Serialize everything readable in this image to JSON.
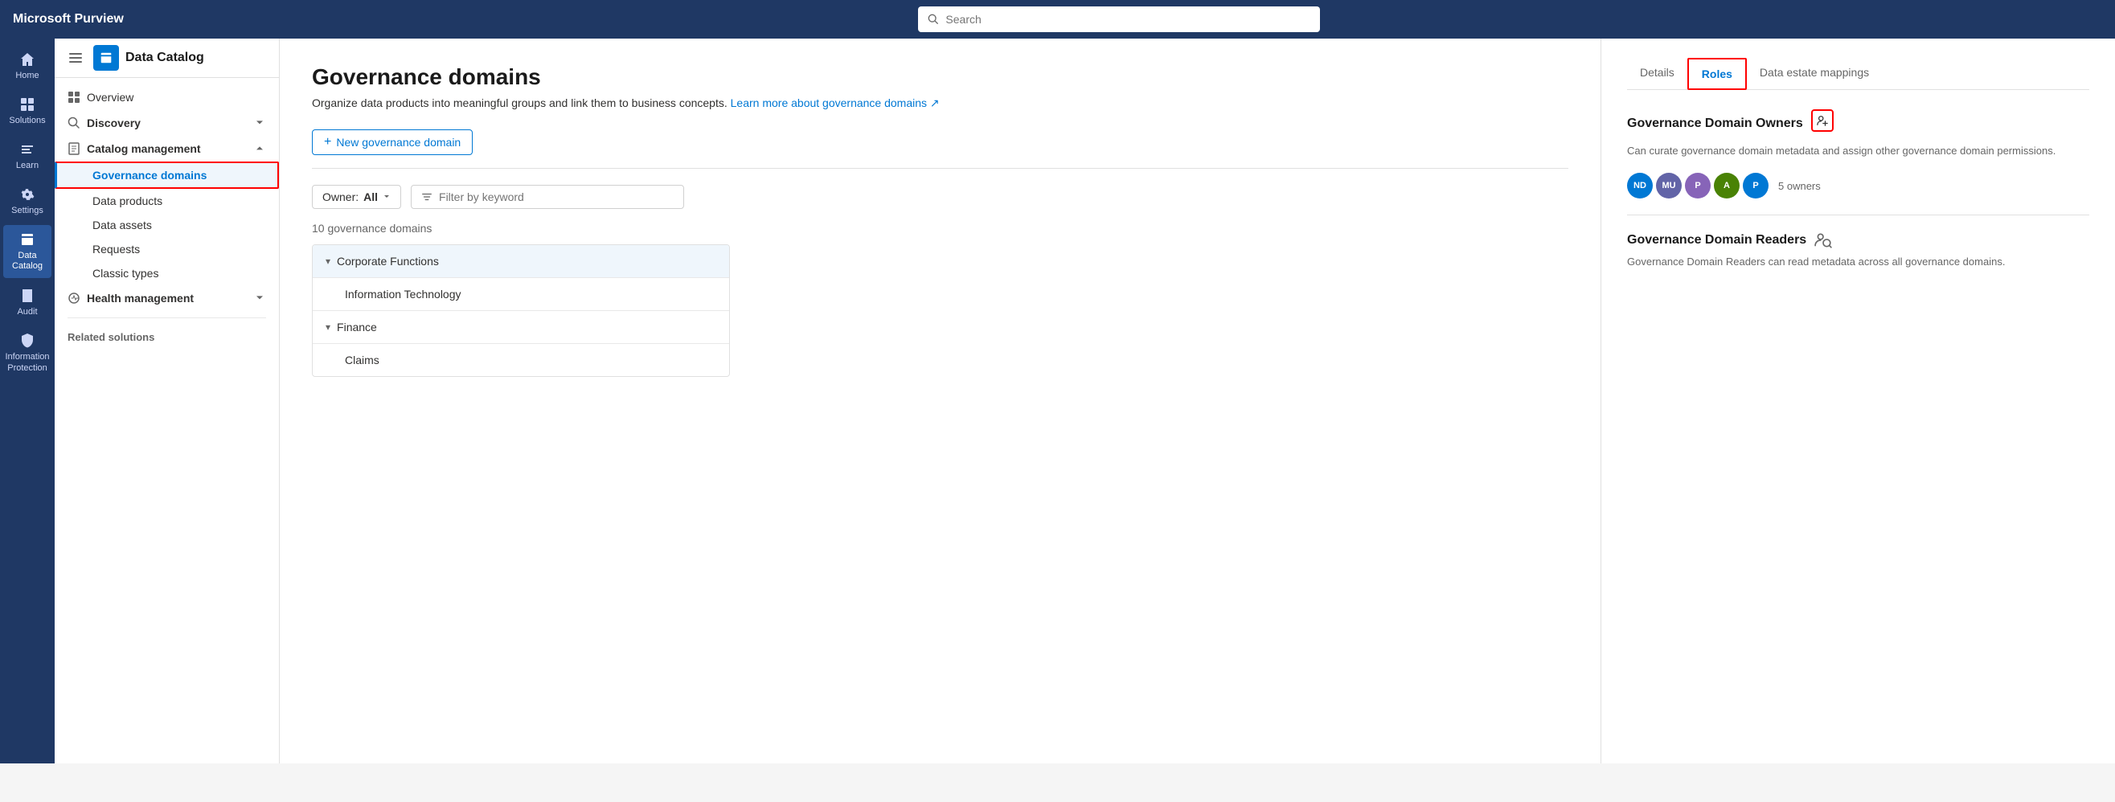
{
  "topbar": {
    "title": "Microsoft Purview",
    "search_placeholder": "Search"
  },
  "icon_nav": {
    "items": [
      {
        "id": "home",
        "label": "Home",
        "icon": "home"
      },
      {
        "id": "solutions",
        "label": "Solutions",
        "icon": "grid"
      },
      {
        "id": "learn",
        "label": "Learn",
        "icon": "book"
      },
      {
        "id": "settings",
        "label": "Settings",
        "icon": "gear"
      },
      {
        "id": "data-catalog",
        "label": "Data Catalog",
        "icon": "catalog",
        "active": true
      },
      {
        "id": "audit",
        "label": "Audit",
        "icon": "audit"
      },
      {
        "id": "info-protection",
        "label": "Information Protection",
        "icon": "shield"
      }
    ]
  },
  "sidebar": {
    "app_name": "Data Catalog",
    "nav_items": [
      {
        "id": "overview",
        "label": "Overview",
        "icon": "grid"
      }
    ],
    "sections": [
      {
        "id": "discovery",
        "label": "Discovery",
        "icon": "search",
        "expanded": false
      },
      {
        "id": "catalog-management",
        "label": "Catalog management",
        "icon": "book",
        "expanded": true,
        "sub_items": [
          {
            "id": "governance-domains",
            "label": "Governance domains",
            "active": true
          },
          {
            "id": "data-products",
            "label": "Data products"
          },
          {
            "id": "data-assets",
            "label": "Data assets"
          },
          {
            "id": "requests",
            "label": "Requests"
          },
          {
            "id": "classic-types",
            "label": "Classic types"
          }
        ]
      },
      {
        "id": "health-management",
        "label": "Health management",
        "icon": "health",
        "expanded": false
      }
    ],
    "related_label": "Related solutions"
  },
  "main": {
    "page_title": "Governance domains",
    "page_desc": "Organize data products into meaningful groups and link them to business concepts.",
    "learn_link": "Learn more about governance domains",
    "new_button": "New governance domain",
    "owner_filter_label": "Owner:",
    "owner_filter_value": "All",
    "filter_placeholder": "Filter by keyword",
    "domains_count": "10 governance domains",
    "domains": [
      {
        "id": "corporate-functions",
        "name": "Corporate Functions",
        "level": 0,
        "expanded": true,
        "has_children": true
      },
      {
        "id": "information-technology",
        "name": "Information Technology",
        "level": 1,
        "expanded": false,
        "has_children": false
      },
      {
        "id": "finance",
        "name": "Finance",
        "level": 0,
        "expanded": true,
        "has_children": true
      },
      {
        "id": "claims",
        "name": "Claims",
        "level": 1,
        "expanded": false,
        "has_children": false
      }
    ]
  },
  "right_panel": {
    "tabs": [
      {
        "id": "details",
        "label": "Details"
      },
      {
        "id": "roles",
        "label": "Roles",
        "active": true
      },
      {
        "id": "data-estate-mappings",
        "label": "Data estate mappings"
      }
    ],
    "owners_section": {
      "title": "Governance Domain Owners",
      "description": "Can curate governance domain metadata and assign other governance domain permissions.",
      "owners": [
        {
          "initials": "ND",
          "color": "#0078d4"
        },
        {
          "initials": "MU",
          "color": "#6264a7"
        },
        {
          "initials": "P",
          "color": "#8764b8"
        },
        {
          "initials": "A",
          "color": "#498205"
        },
        {
          "initials": "P",
          "color": "#0078d4"
        }
      ],
      "owners_count": "5 owners"
    },
    "readers_section": {
      "title": "Governance Domain Readers",
      "description": "Governance Domain Readers can read metadata across all governance domains."
    }
  }
}
